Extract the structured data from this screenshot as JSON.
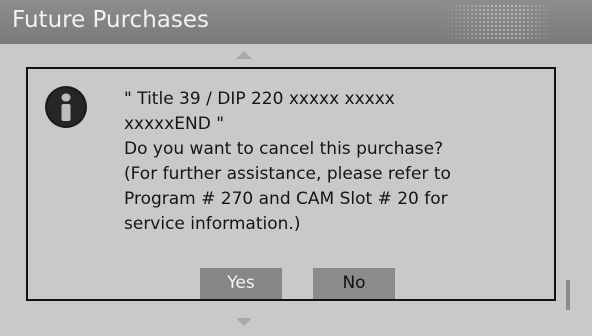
{
  "header": {
    "title": "Future Purchases"
  },
  "dialog": {
    "icon": "info-icon",
    "message_lines": [
      "\" Title 39 / DIP 220 xxxxx xxxxx",
      "xxxxxEND \"",
      "Do you want to cancel this purchase?",
      "(For further assistance, please refer to",
      "Program # 270 and CAM Slot # 20 for",
      "service information.)"
    ],
    "yes_label": "Yes",
    "no_label": "No"
  },
  "colors": {
    "title_bar": "#808080",
    "background": "#c9c9c9",
    "selected_button": "#868686",
    "text": "#151515"
  }
}
